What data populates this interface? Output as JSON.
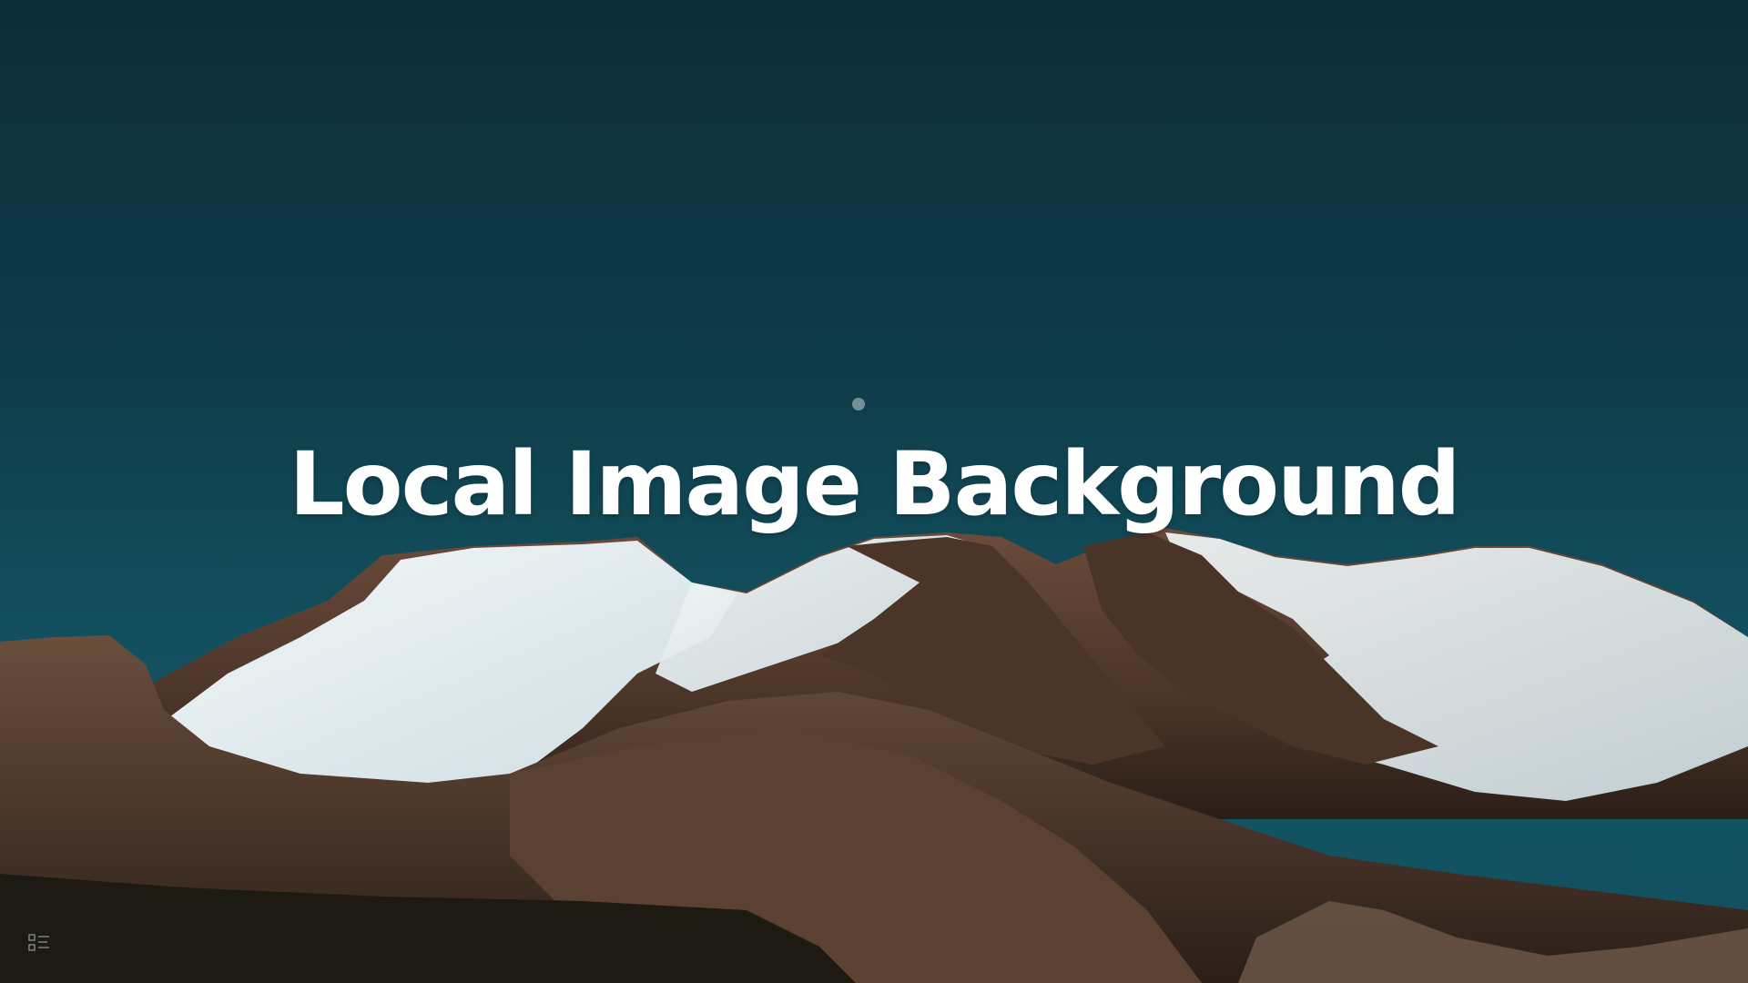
{
  "slide": {
    "title": "Local Image Background"
  },
  "controls": {
    "menu_icon": "slide-menu-icon"
  },
  "colors": {
    "sky_top": "#0d2d38",
    "sky_bottom": "#13515f",
    "title": "#ffffff",
    "snow": "#e6eef0",
    "rock": "#5a3e30"
  }
}
